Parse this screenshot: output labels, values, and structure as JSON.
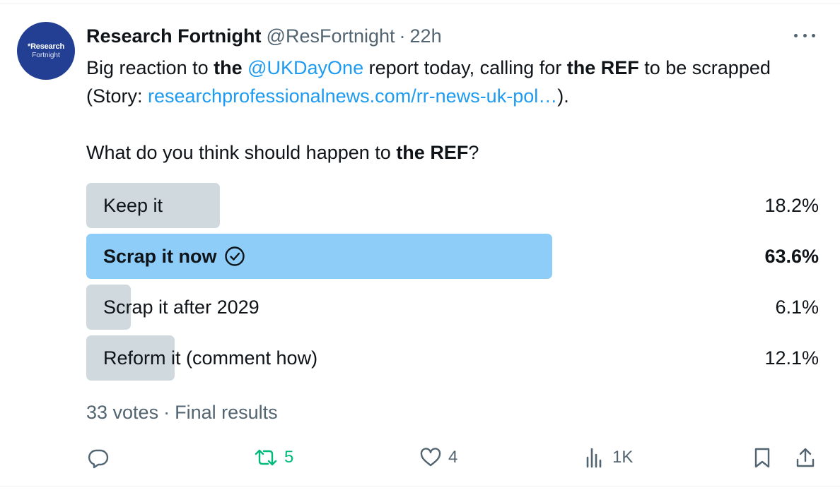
{
  "tweet": {
    "avatar": {
      "logo_text": "*Research",
      "logo_subtext": "Fortnight"
    },
    "author_name": "Research Fortnight",
    "handle": "@ResFortnight",
    "separator": "·",
    "time": "22h",
    "body": {
      "t1": "Big reaction to ",
      "t2": "the",
      "t3": " ",
      "mention": "@UKDayOne",
      "t4": " report today, calling for ",
      "t5": "the REF",
      "t6": " to be scrapped (Story: ",
      "url": "researchprofessionalnews.com/rr-news-uk-pol…",
      "t7": ").",
      "q1": "What do you think should happen to ",
      "q2": "the REF",
      "q3": "?"
    },
    "poll": {
      "options": [
        {
          "label": "Keep it",
          "percent": "18.2%",
          "fraction": 0.182,
          "winner": false
        },
        {
          "label": "Scrap it now",
          "percent": "63.6%",
          "fraction": 0.636,
          "winner": true
        },
        {
          "label": "Scrap it after 2029",
          "percent": "6.1%",
          "fraction": 0.061,
          "winner": false
        },
        {
          "label": "Reform it (comment how)",
          "percent": "12.1%",
          "fraction": 0.121,
          "winner": false
        }
      ],
      "votes": "33 votes",
      "separator": "·",
      "status": "Final results"
    },
    "actions": {
      "reply_icon": "reply-icon",
      "retweet_icon": "retweet-icon",
      "retweet_count": "5",
      "like_icon": "heart-icon",
      "like_count": "4",
      "views_icon": "views-icon",
      "views_count": "1K",
      "bookmark_icon": "bookmark-icon",
      "share_icon": "share-icon"
    },
    "colors": {
      "text": "#0f1419",
      "secondary": "#536471",
      "link": "#1d9bf0",
      "retweet_green": "#00ba7c",
      "poll_bar": "#cfd9de",
      "poll_winner": "#8ecdf8",
      "avatar_bg": "#223f94"
    }
  }
}
